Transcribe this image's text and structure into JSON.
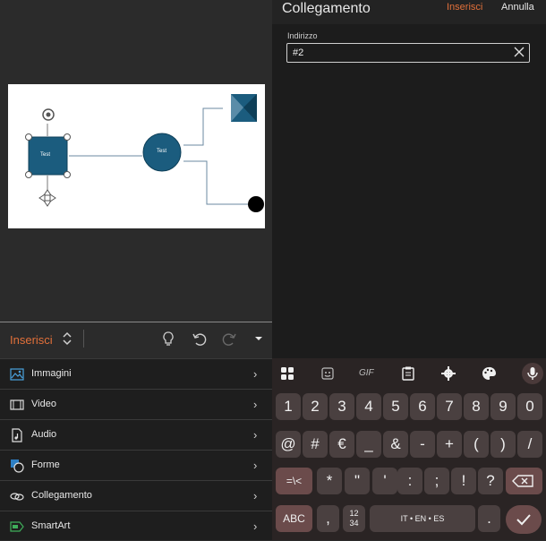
{
  "dialog": {
    "title": "Collegamento",
    "insert_label": "Inserisci",
    "cancel_label": "Annulla",
    "field_label": "Indirizzo",
    "field_value": "#2"
  },
  "slide": {
    "shape1_text": "Test",
    "shape2_text": "Test"
  },
  "toolbar": {
    "tab_label": "Inserisci"
  },
  "menu": {
    "items": [
      {
        "label": "Immagini",
        "icon": "image-icon"
      },
      {
        "label": "Video",
        "icon": "film-icon"
      },
      {
        "label": "Audio",
        "icon": "audio-file-icon"
      },
      {
        "label": "Forme",
        "icon": "shapes-icon"
      },
      {
        "label": "Collegamento",
        "icon": "link-icon"
      },
      {
        "label": "SmartArt",
        "icon": "smartart-icon"
      }
    ]
  },
  "keyboard": {
    "gif_label": "GIF",
    "row1": [
      "1",
      "2",
      "3",
      "4",
      "5",
      "6",
      "7",
      "8",
      "9",
      "0"
    ],
    "row2": [
      "@",
      "#",
      "€",
      "_",
      "&",
      "-",
      "+",
      "(",
      ")",
      "/"
    ],
    "row3": [
      "=\\<",
      "*",
      "\"",
      "'",
      ":",
      ";",
      "!",
      "?"
    ],
    "abc_label": "ABC",
    "comma": ",",
    "numpad_top": "12",
    "numpad_bottom": "34",
    "space_label": "IT • EN • ES",
    "period": "."
  },
  "colors": {
    "accent": "#e2703a",
    "shape_fill": "#1b5c7e"
  }
}
